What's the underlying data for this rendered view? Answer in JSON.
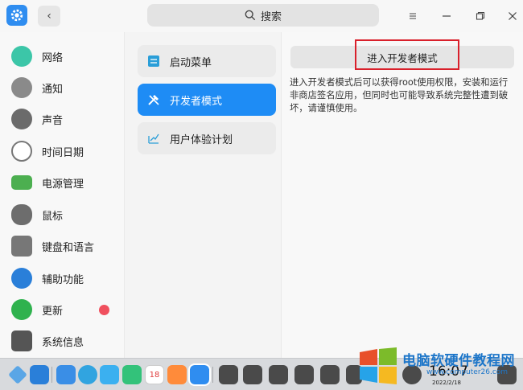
{
  "titlebar": {
    "search_placeholder": "搜索"
  },
  "sidebar": {
    "items": [
      {
        "label": "网络",
        "icon": "network-icon",
        "color": "#3cc6a8"
      },
      {
        "label": "通知",
        "icon": "bell-icon",
        "color": "#8a8a8a"
      },
      {
        "label": "声音",
        "icon": "speaker-icon",
        "color": "#6b6b6b"
      },
      {
        "label": "时间日期",
        "icon": "clock-icon",
        "color": "#777777"
      },
      {
        "label": "电源管理",
        "icon": "battery-icon",
        "color": "#4caf50"
      },
      {
        "label": "鼠标",
        "icon": "mouse-icon",
        "color": "#6d6d6d"
      },
      {
        "label": "键盘和语言",
        "icon": "keyboard-icon",
        "color": "#777777"
      },
      {
        "label": "辅助功能",
        "icon": "accessibility-icon",
        "color": "#2a7fd9"
      },
      {
        "label": "更新",
        "icon": "update-icon",
        "color": "#2fb24e",
        "badge": true
      },
      {
        "label": "系统信息",
        "icon": "system-info-icon",
        "color": "#555555"
      }
    ]
  },
  "middle": {
    "items": [
      {
        "label": "启动菜单",
        "icon": "boot-menu-icon",
        "active": false
      },
      {
        "label": "开发者模式",
        "icon": "developer-tools-icon",
        "active": true
      },
      {
        "label": "用户体验计划",
        "icon": "user-experience-icon",
        "active": false
      }
    ]
  },
  "content": {
    "button_label": "进入开发者模式",
    "description": "进入开发者模式后可以获得root使用权限，安装和运行非商店签名应用，但同时也可能导致系统完整性遭到破坏，请谨慎使用。"
  },
  "dock": {
    "time": "16:07",
    "date": "2022/2/18",
    "calendar_day": "18"
  },
  "watermark": {
    "title": "电脑软硬件教程网",
    "url": "www.computer26.com"
  },
  "colors": {
    "accent": "#1e8cf5",
    "highlight_border": "#d9202b",
    "badge": "#f0505e"
  }
}
